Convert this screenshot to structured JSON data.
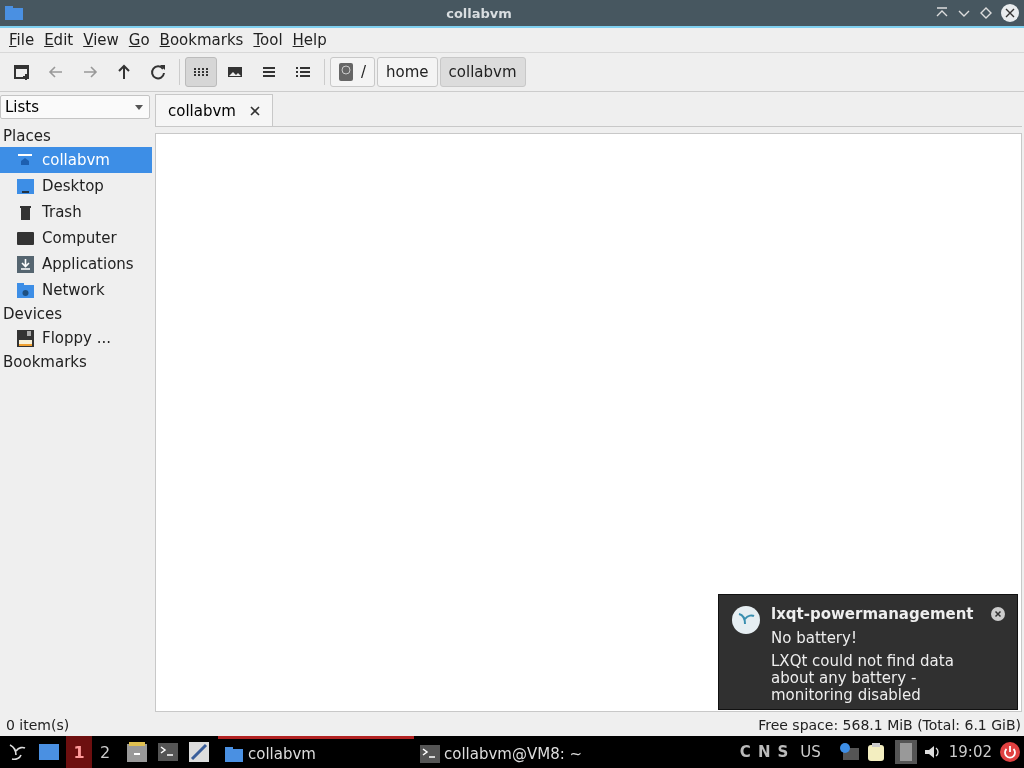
{
  "window": {
    "title": "collabvm"
  },
  "menu": [
    "File",
    "Edit",
    "View",
    "Go",
    "Bookmarks",
    "Tool",
    "Help"
  ],
  "toolbar": [
    {
      "kind": "new-tab",
      "selected": false
    },
    {
      "kind": "back",
      "selected": false
    },
    {
      "kind": "forward",
      "selected": false
    },
    {
      "kind": "up",
      "selected": false
    },
    {
      "kind": "reload",
      "selected": false
    },
    {
      "kind": "icons",
      "selected": true
    },
    {
      "kind": "thumbnails",
      "selected": false
    },
    {
      "kind": "compact",
      "selected": false
    },
    {
      "kind": "details",
      "selected": false
    }
  ],
  "path": [
    {
      "label": "/",
      "selected": false
    },
    {
      "label": "home",
      "selected": false
    },
    {
      "label": "collabvm",
      "selected": true
    }
  ],
  "side_pane": {
    "mode": "Lists",
    "sections": [
      {
        "title": "Places",
        "items": [
          {
            "label": "collabvm",
            "kind": "home",
            "selected": true
          },
          {
            "label": "Desktop",
            "kind": "desktop",
            "selected": false
          },
          {
            "label": "Trash",
            "kind": "trash",
            "selected": false
          },
          {
            "label": "Computer",
            "kind": "computer",
            "selected": false
          },
          {
            "label": "Applications",
            "kind": "apps",
            "selected": false
          },
          {
            "label": "Network",
            "kind": "network",
            "selected": false
          }
        ]
      },
      {
        "title": "Devices",
        "items": [
          {
            "label": "Floppy ...",
            "kind": "floppy",
            "selected": false
          }
        ]
      },
      {
        "title": "Bookmarks"
      }
    ]
  },
  "tabs": [
    {
      "label": "collabvm",
      "selected": true
    }
  ],
  "status_bar": {
    "items": "0 item(s)",
    "free_space": "Free space: 568.1 MiB (Total: 6.1 GiB)"
  },
  "notification": {
    "app": "lxqt-powermanagement",
    "summary": "No battery!",
    "body": "LXQt could not find data about any battery - monitoring disabled"
  },
  "taskbar": {
    "workspaces": [
      {
        "label": "1",
        "selected": true
      },
      {
        "label": "2",
        "selected": false
      }
    ],
    "tasks": [
      {
        "label": "collabvm",
        "kind": "folder",
        "selected": true
      },
      {
        "label": "collabvm@VM8: ~",
        "kind": "terminal",
        "selected": false
      }
    ],
    "locks": [
      "C",
      "N",
      "S"
    ],
    "layout": "US",
    "clock": "19:02"
  }
}
